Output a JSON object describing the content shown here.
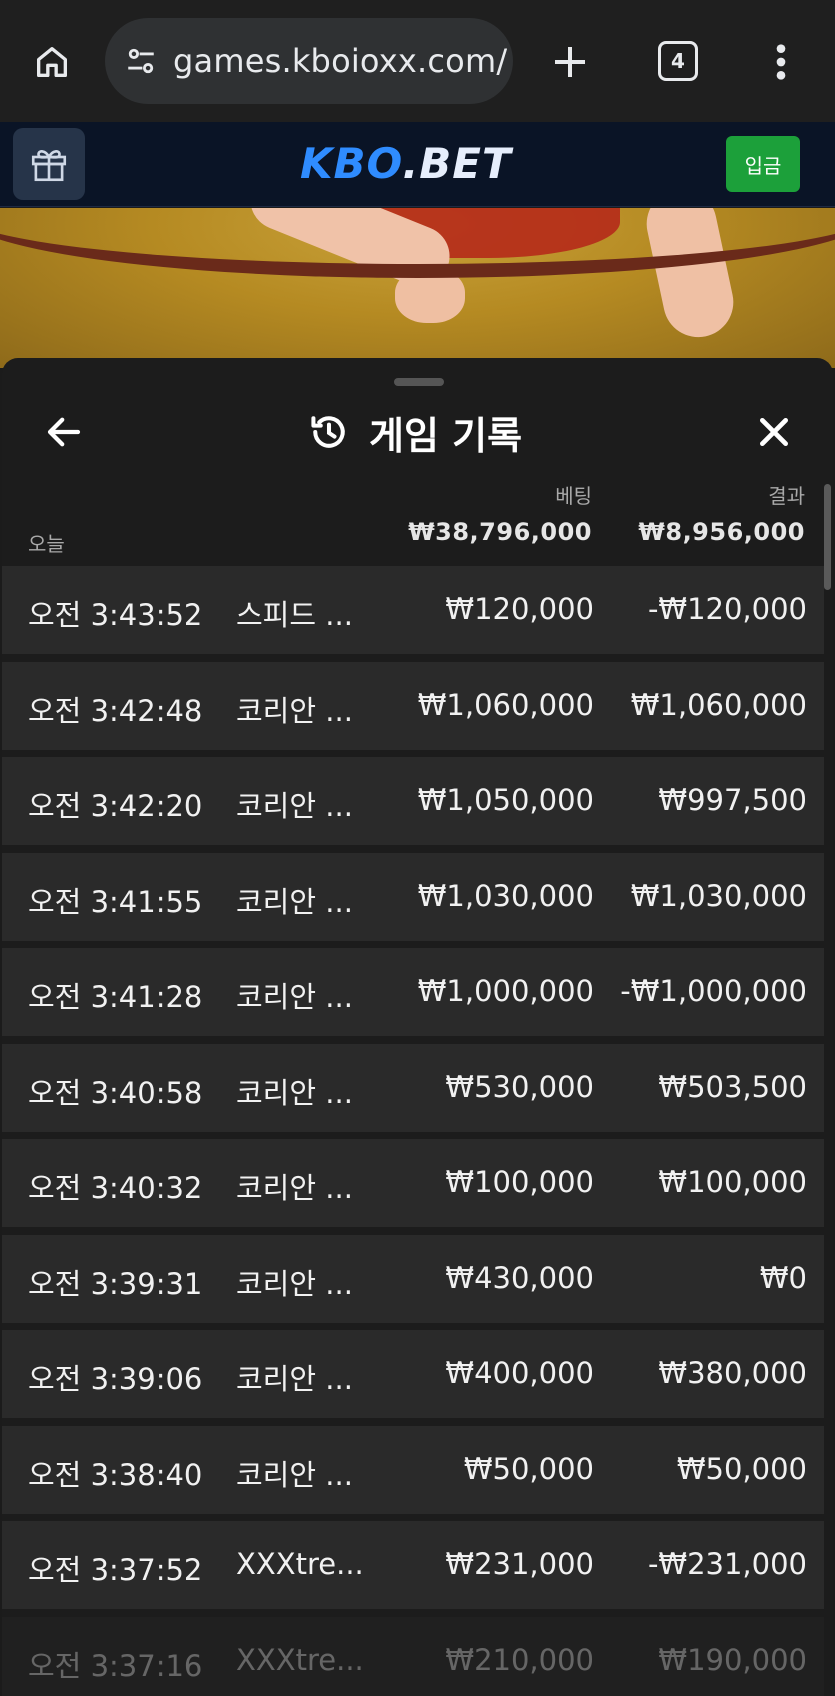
{
  "browser": {
    "url": "games.kboioxx.com/",
    "tab_count": "4",
    "icons": {
      "home": "home-icon",
      "site_settings": "tune-icon",
      "new_tab": "plus-icon",
      "menu": "more-vert-icon"
    }
  },
  "site_header": {
    "logo_part1": "KBO",
    "logo_part2": ".BET",
    "deposit_label": "입금",
    "gift_icon": "gift-icon",
    "colors": {
      "background": "#0a1426",
      "logo_accent": "#2f8cff",
      "deposit_button": "#1ca03a"
    }
  },
  "panel": {
    "title": "게임 기록",
    "history_icon": "history-icon",
    "back_icon": "arrow-left-icon",
    "close_icon": "close-icon",
    "columns": {
      "bet": "베팅",
      "result": "결과"
    },
    "group_label": "오늘",
    "totals": {
      "bet": "₩38,796,000",
      "result": "₩8,956,000"
    },
    "rows": [
      {
        "time": "오전 3:43:52",
        "game": "스피드 ...",
        "bet": "₩120,000",
        "result": "-₩120,000"
      },
      {
        "time": "오전 3:42:48",
        "game": "코리안 ...",
        "bet": "₩1,060,000",
        "result": "₩1,060,000"
      },
      {
        "time": "오전 3:42:20",
        "game": "코리안 ...",
        "bet": "₩1,050,000",
        "result": "₩997,500"
      },
      {
        "time": "오전 3:41:55",
        "game": "코리안 ...",
        "bet": "₩1,030,000",
        "result": "₩1,030,000"
      },
      {
        "time": "오전 3:41:28",
        "game": "코리안 ...",
        "bet": "₩1,000,000",
        "result": "-₩1,000,000"
      },
      {
        "time": "오전 3:40:58",
        "game": "코리안 ...",
        "bet": "₩530,000",
        "result": "₩503,500"
      },
      {
        "time": "오전 3:40:32",
        "game": "코리안 ...",
        "bet": "₩100,000",
        "result": "₩100,000"
      },
      {
        "time": "오전 3:39:31",
        "game": "코리안 ...",
        "bet": "₩430,000",
        "result": "₩0"
      },
      {
        "time": "오전 3:39:06",
        "game": "코리안 ...",
        "bet": "₩400,000",
        "result": "₩380,000"
      },
      {
        "time": "오전 3:38:40",
        "game": "코리안 ...",
        "bet": "₩50,000",
        "result": "₩50,000"
      },
      {
        "time": "오전 3:37:52",
        "game": "XXXtre...",
        "bet": "₩231,000",
        "result": "-₩231,000"
      },
      {
        "time": "오전 3:37:16",
        "game": "XXXtre...",
        "bet": "₩210,000",
        "result": "₩190,000"
      }
    ]
  }
}
